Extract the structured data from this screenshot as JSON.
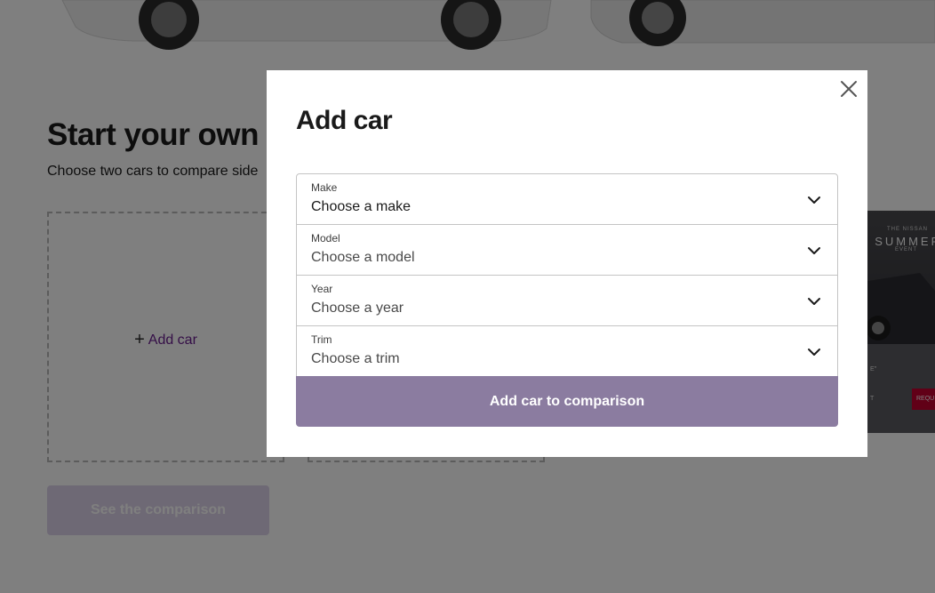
{
  "background": {
    "section_title": "Start your own c",
    "section_subtitle": "Choose two cars to compare side",
    "slot_add_label": "Add car",
    "see_comparison_label": "See the comparison",
    "ad": {
      "line_small": "THE NISSAN",
      "line_big": "SUMMER",
      "line_event": "EVENT",
      "foot_1": "E\"",
      "foot_2": "T",
      "cta": "REQU"
    }
  },
  "modal": {
    "title": "Add car",
    "fields": [
      {
        "label": "Make",
        "value": "Choose a make"
      },
      {
        "label": "Model",
        "value": "Choose a model"
      },
      {
        "label": "Year",
        "value": "Choose a year"
      },
      {
        "label": "Trim",
        "value": "Choose a trim"
      }
    ],
    "submit_label": "Add car to comparison"
  },
  "colors": {
    "accent": "#6a1e8f",
    "submit_disabled": "#8b7ca0",
    "ad_cta": "#c3002f"
  },
  "icons": [
    "close-icon",
    "chevron-down-icon",
    "plus-icon"
  ]
}
